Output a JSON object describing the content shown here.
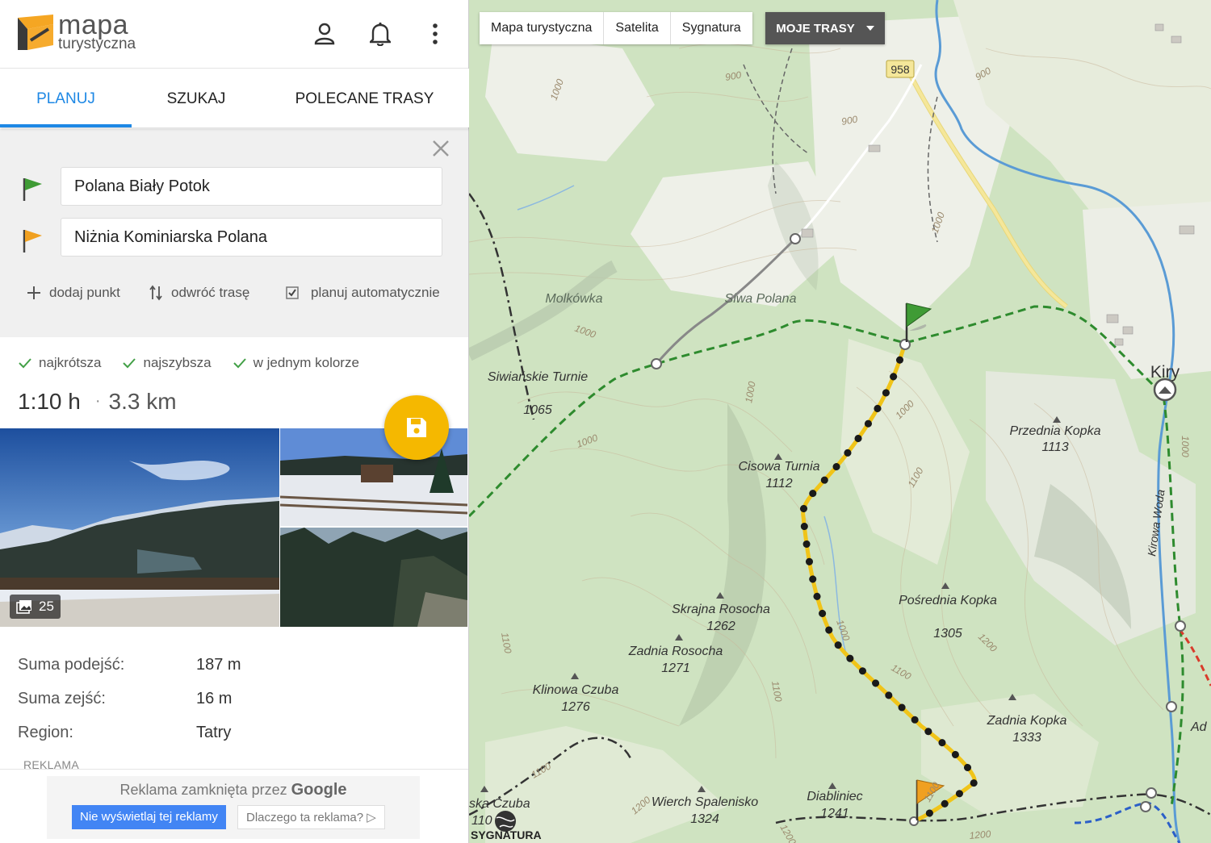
{
  "app": {
    "logo_line1": "mapa",
    "logo_line2": "turystyczna"
  },
  "tabs": [
    "PLANUJ",
    "SZUKAJ",
    "POLECANE TRASY"
  ],
  "route": {
    "from": "Polana Biały Potok",
    "to": "Niżnia Kominiarska Polana"
  },
  "actions": {
    "add_point": "dodaj punkt",
    "reverse": "odwróć trasę",
    "auto_plan": "planuj automatycznie",
    "auto_plan_checked": true
  },
  "options": [
    "najkrótsza",
    "najszybsza",
    "w jednym kolorze"
  ],
  "summary": {
    "time": "1:10 h",
    "distance": "3.3 km"
  },
  "photos": {
    "count": "25"
  },
  "stats": [
    {
      "label": "Suma podejść:",
      "value": "187 m"
    },
    {
      "label": "Suma zejść:",
      "value": "16 m"
    },
    {
      "label": "Region:",
      "value": "Tatry"
    }
  ],
  "ad": {
    "label": "REKLAMA",
    "closed_text": "Reklama zamknięta przez",
    "brand": "Google",
    "btn_hide": "Nie wyświetlaj tej reklamy",
    "btn_why": "Dlaczego ta reklama?"
  },
  "map_controls": {
    "layers": [
      "Mapa turystyczna",
      "Satelita",
      "Sygnatura"
    ],
    "my_routes": "MOJE TRASY"
  },
  "map": {
    "road_number": "958",
    "places": [
      {
        "name": "Molkówka"
      },
      {
        "name": "Siwa Polana"
      },
      {
        "name": "Kiry"
      },
      {
        "name": "Siwiańskie Turnie",
        "elev": "1065"
      },
      {
        "name": "Cisowa Turnia",
        "elev": "1112"
      },
      {
        "name": "Przednia Kopka",
        "elev": "1113"
      },
      {
        "name": "Skrajna Rosocha",
        "elev": "1262"
      },
      {
        "name": "Zadnia Rosocha",
        "elev": "1271"
      },
      {
        "name": "Klinowa Czuba",
        "elev": "1276"
      },
      {
        "name": "Pośrednia Kopka",
        "elev": "1305"
      },
      {
        "name": "Zadnia Kopka",
        "elev": "1333"
      },
      {
        "name": "Wierch Spalenisko",
        "elev": "1324"
      },
      {
        "name": "Diabliniec",
        "elev": "1241"
      },
      {
        "name": "ska Czuba",
        "elev": "110"
      },
      {
        "name": "Ad"
      }
    ],
    "stream": "Kirowa Woda",
    "contours": [
      "1000",
      "900",
      "900",
      "1000",
      "900",
      "1000",
      "1000",
      "1000",
      "1000",
      "1100",
      "1100",
      "1000",
      "1200",
      "1100",
      "1100",
      "1000",
      "1100",
      "1200",
      "1100",
      "1200",
      "1200"
    ],
    "signature": "SYGNATURA",
    "colors": {
      "forest": "#cfe3c1",
      "clearing": "#eef0e8",
      "trail_green": "#2e8b2e",
      "route": "#f0c419",
      "water": "#5a9bd5",
      "road": "#f5e79a"
    }
  }
}
